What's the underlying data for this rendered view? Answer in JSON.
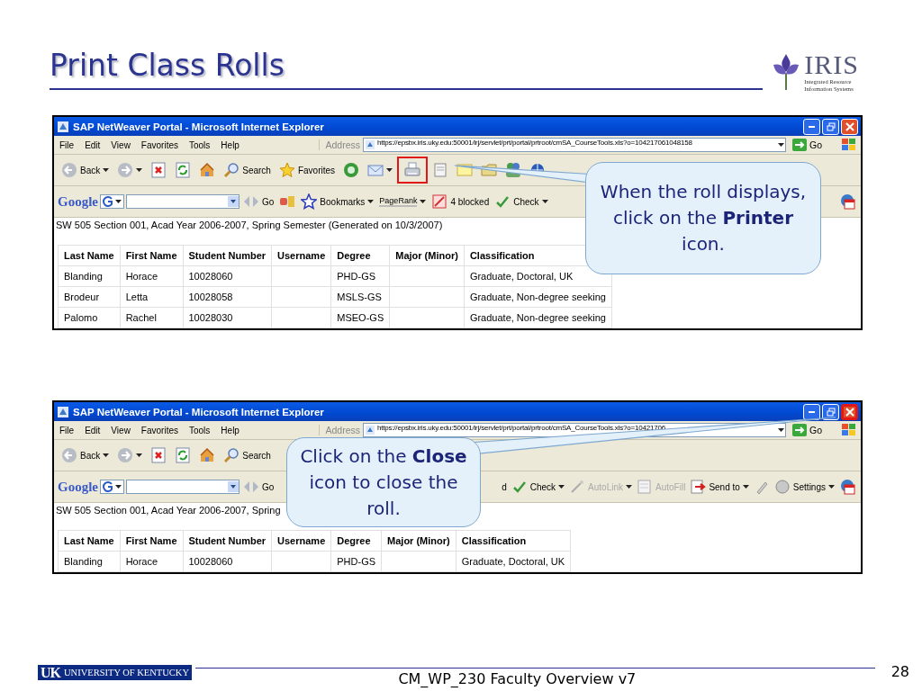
{
  "slide": {
    "title": "Print Class Rolls",
    "page_number": "28",
    "footer_text": "CM_WP_230 Faculty Overview v7"
  },
  "logo": {
    "name": "IRIS",
    "line_1": "Integrated Resource",
    "line_2": "Information Systems"
  },
  "university_logo": {
    "initials": "UK",
    "name": "UNIVERSITY OF KENTUCKY"
  },
  "screenshots": [
    {
      "title": "SAP NetWeaver Portal - Microsoft Internet Explorer",
      "print_highlighted": true,
      "close_highlighted": false,
      "menu": [
        "File",
        "Edit",
        "View",
        "Favorites",
        "Tools",
        "Help"
      ],
      "address_label": "Address",
      "url": "https://epsbx.iris.uky.edu:50001/irj/servlet/prt/portal/prtroot/cmSA_CourseTools.xls?o=104217061048158",
      "go": "Go",
      "toolbar": [
        {
          "kind": "back",
          "label": "Back"
        },
        {
          "kind": "forward"
        },
        {
          "kind": "stop"
        },
        {
          "kind": "refresh"
        },
        {
          "kind": "home"
        },
        {
          "kind": "search",
          "label": "Search"
        },
        {
          "kind": "favorites",
          "label": "Favorites"
        },
        {
          "kind": "media"
        },
        {
          "kind": "mail"
        },
        {
          "kind": "print"
        },
        {
          "kind": "edit"
        },
        {
          "kind": "note"
        },
        {
          "kind": "folder"
        },
        {
          "kind": "people"
        },
        {
          "kind": "globe"
        }
      ],
      "google_logo": "Google",
      "google_bar_left": [
        {
          "kind": "go",
          "label": "Go"
        },
        {
          "kind": "tools"
        },
        {
          "kind": "bookmarks",
          "label": "Bookmarks"
        },
        {
          "kind": "pagerank",
          "label": "PageRank"
        },
        {
          "kind": "blocked",
          "label": "4 blocked"
        },
        {
          "kind": "check",
          "label": "Check"
        }
      ],
      "google_bar_right": [
        {
          "kind": "pdf"
        }
      ],
      "report_heading": "SW 505 Section 001, Acad Year 2006-2007, Spring Semester (Generated on 10/3/2007)",
      "table": {
        "columns": [
          "Last Name",
          "First Name",
          "Student Number",
          "Username",
          "Degree",
          "Major (Minor)",
          "Classification"
        ],
        "rows": [
          [
            "Blanding",
            "Horace",
            "10028060",
            "",
            "PHD-GS",
            "",
            "Graduate, Doctoral, UK"
          ],
          [
            "Brodeur",
            "Letta",
            "10028058",
            "",
            "MSLS-GS",
            "",
            "Graduate, Non-degree seeking"
          ],
          [
            "Palomo",
            "Rachel",
            "10028030",
            "",
            "MSEO-GS",
            "",
            "Graduate, Non-degree seeking"
          ]
        ]
      },
      "callout": "When the roll displays, click on the **Printer** icon."
    },
    {
      "title": "SAP NetWeaver Portal - Microsoft Internet Explorer",
      "close_highlighted": true,
      "menu": [
        "File",
        "Edit",
        "View",
        "Favorites",
        "Tools",
        "Help"
      ],
      "address_label": "Address",
      "url": "https://epsbx.iris.uky.edu:50001/irj/servlet/prt/portal/prtroot/cmSA_CourseTools.xls?o=10421706",
      "go": "Go",
      "toolbar": [
        {
          "kind": "back",
          "label": "Back"
        },
        {
          "kind": "forward"
        },
        {
          "kind": "stop"
        },
        {
          "kind": "refresh"
        },
        {
          "kind": "home"
        },
        {
          "kind": "search",
          "label": "Search"
        }
      ],
      "google_logo": "Google",
      "google_bar_left": [
        {
          "kind": "go",
          "label": "Go"
        }
      ],
      "google_bar_right": [
        {
          "kind": "blocked-end",
          "label": "d"
        },
        {
          "kind": "check",
          "label": "Check"
        },
        {
          "kind": "autolink",
          "label": "AutoLink"
        },
        {
          "kind": "autofill",
          "label": "AutoFill"
        },
        {
          "kind": "sendto",
          "label": "Send to"
        },
        {
          "kind": "pencil"
        },
        {
          "kind": "settings",
          "label": "Settings"
        },
        {
          "kind": "pdf"
        }
      ],
      "report_heading": "SW 505 Section 001, Acad Year 2006-2007, Spring",
      "table": {
        "columns": [
          "Last Name",
          "First Name",
          "Student Number",
          "Username",
          "Degree",
          "Major (Minor)",
          "Classification"
        ],
        "rows": [
          [
            "Blanding",
            "Horace",
            "10028060",
            "",
            "PHD-GS",
            "",
            "Graduate, Doctoral, UK"
          ]
        ]
      },
      "callout": "Click on the **Close** icon to close the roll."
    }
  ]
}
